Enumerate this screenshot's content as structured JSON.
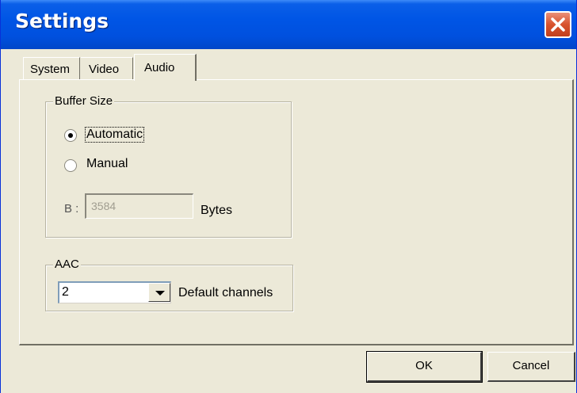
{
  "window": {
    "title": "Settings"
  },
  "tabs": [
    {
      "label": "System"
    },
    {
      "label": "Video"
    },
    {
      "label": "Audio",
      "selected": true
    }
  ],
  "buffer": {
    "group_label": "Buffer Size",
    "options": [
      {
        "label": "Automatic",
        "selected": true
      },
      {
        "label": "Manual",
        "selected": false
      }
    ],
    "b_label": "B :",
    "b_value": "3584",
    "b_unit": "Bytes"
  },
  "aac": {
    "group_label": "AAC",
    "channels_value": "2",
    "channels_label": "Default channels"
  },
  "buttons": {
    "ok": "OK",
    "cancel": "Cancel"
  },
  "colors": {
    "titlebar": "#0055e5",
    "close": "#d8522d",
    "face": "#ece9d8"
  },
  "icons": {
    "close": "close-icon",
    "dropdown": "chevron-down-icon"
  }
}
